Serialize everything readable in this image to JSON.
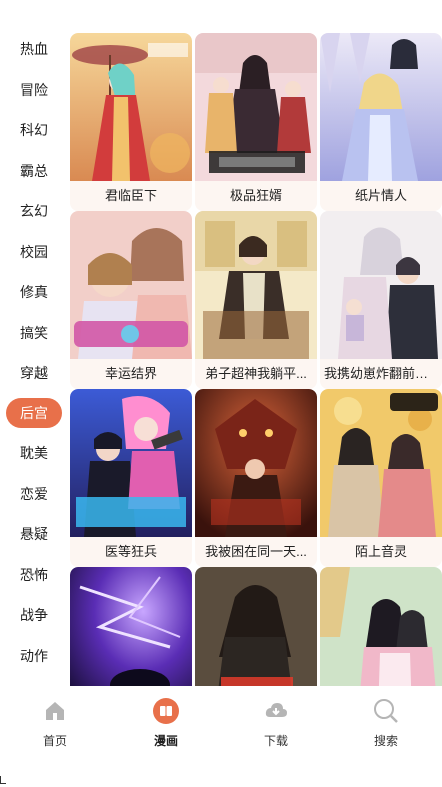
{
  "sidebar": {
    "categories": [
      "热血",
      "冒险",
      "科幻",
      "霸总",
      "玄幻",
      "校园",
      "修真",
      "搞笑",
      "穿越",
      "后宫",
      "耽美",
      "恋爱",
      "悬疑",
      "恐怖",
      "战争",
      "动作"
    ],
    "active_index": 9
  },
  "grid": {
    "items": [
      {
        "title": "君临臣下"
      },
      {
        "title": "极品狂婿"
      },
      {
        "title": "纸片情人"
      },
      {
        "title": "幸运结界"
      },
      {
        "title": "弟子超神我躺平..."
      },
      {
        "title": "我携幼崽炸翻前夫..."
      },
      {
        "title": "医等狂兵"
      },
      {
        "title": "我被困在同一天..."
      },
      {
        "title": "陌上音灵"
      },
      {
        "title": ""
      },
      {
        "title": ""
      },
      {
        "title": ""
      }
    ]
  },
  "bottom_nav": {
    "items": [
      {
        "label": "首页",
        "icon": "home-icon"
      },
      {
        "label": "漫画",
        "icon": "comic-book-icon"
      },
      {
        "label": "下载",
        "icon": "download-icon"
      },
      {
        "label": "搜索",
        "icon": "search-icon"
      }
    ],
    "active_index": 1
  },
  "colors": {
    "accent": "#e8704a",
    "inactive_icon": "#b5b5b5"
  }
}
